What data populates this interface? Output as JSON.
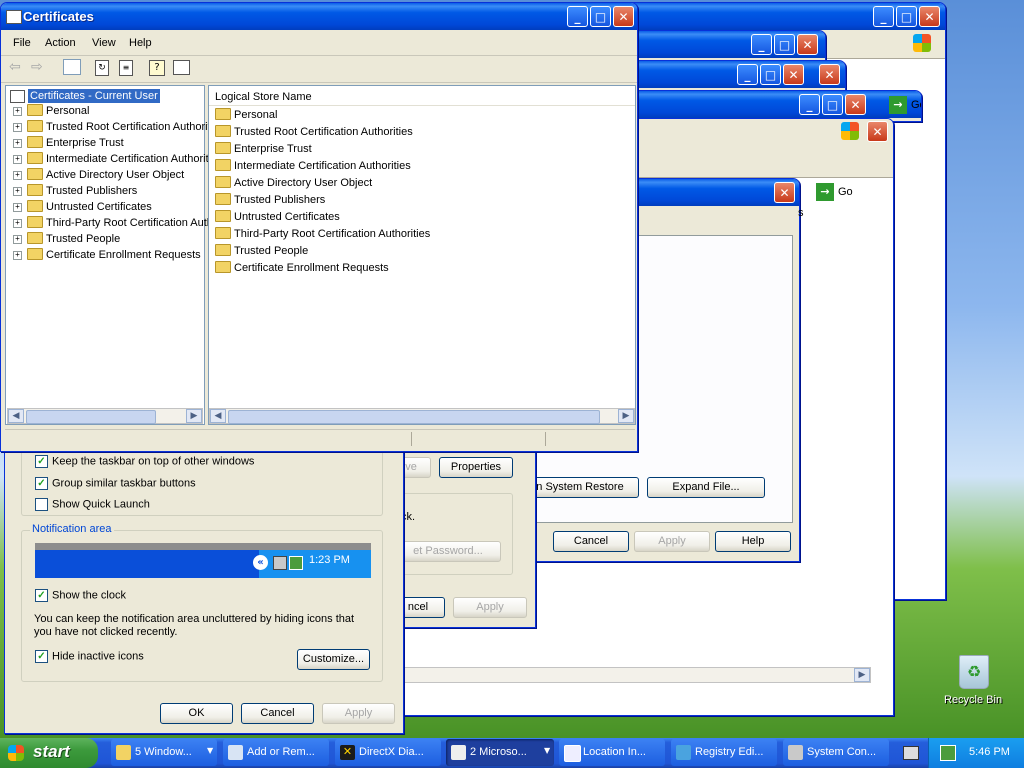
{
  "certificates_window": {
    "title": "Certificates",
    "menu": [
      "File",
      "Action",
      "View",
      "Help"
    ],
    "tree_root": "Certificates - Current User",
    "tree_items": [
      "Personal",
      "Trusted Root Certification Authorities",
      "Enterprise Trust",
      "Intermediate Certification Authorities",
      "Active Directory User Object",
      "Trusted Publishers",
      "Untrusted Certificates",
      "Third-Party Root Certification Authorities",
      "Trusted People",
      "Certificate Enrollment Requests"
    ],
    "list_header": "Logical Store Name",
    "list_items": [
      "Personal",
      "Trusted Root Certification Authorities",
      "Enterprise Trust",
      "Intermediate Certification Authorities",
      "Active Directory User Object",
      "Trusted Publishers",
      "Untrusted Certificates",
      "Third-Party Root Certification Authorities",
      "Trusted People",
      "Certificate Enrollment Requests"
    ]
  },
  "taskbar_props": {
    "keep_on_top": "Keep the taskbar on top of other windows",
    "group_similar": "Group similar taskbar buttons",
    "quick_launch": "Show Quick Launch",
    "notification_group": "Notification area",
    "preview_time": "1:23 PM",
    "show_clock": "Show the clock",
    "description": "You can keep the notification area uncluttered by hiding icons that you have not clicked recently.",
    "hide_inactive": "Hide inactive icons",
    "customize": "Customize...",
    "ok": "OK",
    "cancel": "Cancel",
    "apply": "Apply"
  },
  "user_props": {
    "fragment_ve": "ve",
    "properties": "Properties",
    "fragment_ck": "ck.",
    "fragment_reset": "et Password...",
    "fragment_cancel": "ncel",
    "apply": "Apply"
  },
  "system_props": {
    "system_restore": "n System Restore",
    "expand_file": "Expand File...",
    "cancel": "Cancel",
    "apply": "Apply",
    "help": "Help",
    "go": "Go",
    "fragment_s": "s"
  },
  "back_window": {
    "go": "Go"
  },
  "desktop": {
    "recycle_bin": "Recycle Bin"
  },
  "taskbar": {
    "start": "start",
    "items": [
      "5 Window...",
      "Add or Rem...",
      "DirectX Dia...",
      "2 Microso...",
      "Location In...",
      "Registry Edi...",
      "System Con..."
    ],
    "clock": "5:46 PM"
  },
  "colors": {
    "xp_blue": "#0054e3",
    "start_green": "#3c9a3c",
    "selection": "#316ac5"
  }
}
